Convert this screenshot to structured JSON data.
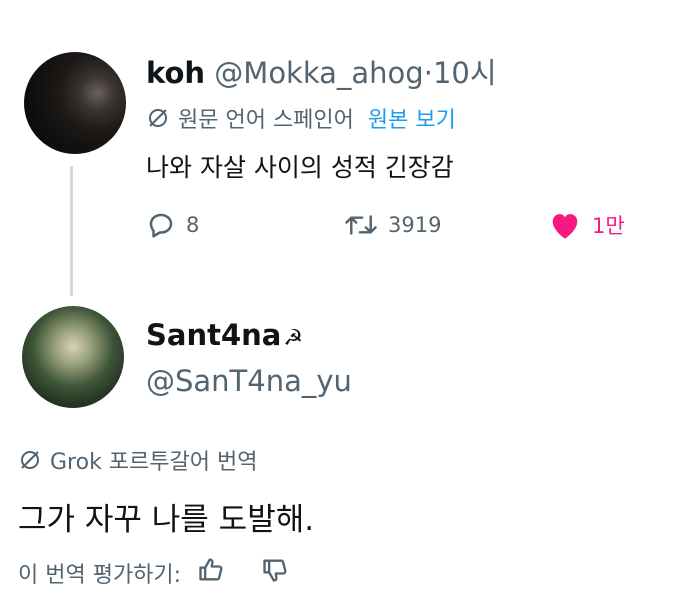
{
  "tweet1": {
    "display_name": "koh",
    "handle": "@Mokka_ahog",
    "separator": "·",
    "time": "10시",
    "translate_note": "원문 언어 스페인어",
    "view_original": "원본 보기",
    "text": "나와 자살 사이의 성적 긴장감",
    "replies": "8",
    "retweets": "3919",
    "likes": "1만",
    "like_color": "#f91880"
  },
  "tweet2": {
    "display_name": "Sant4na",
    "name_emoji": "☭",
    "handle": "@SanT4na_yu",
    "translate_note": "Grok 포르투갈어 번역",
    "text": "그가 자꾸 나를 도발해.",
    "rate_prompt": "이 번역 평가하기:"
  }
}
